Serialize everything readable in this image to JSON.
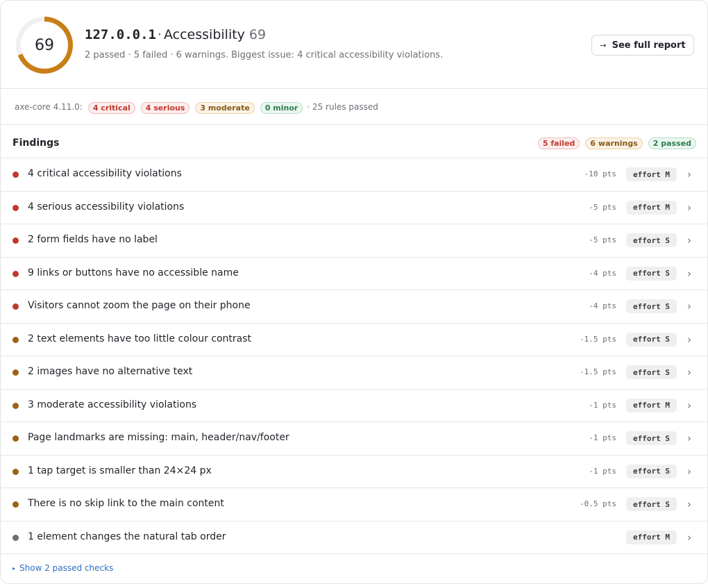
{
  "header": {
    "score": "69",
    "score_fraction": 0.69,
    "gauge_color": "#c87f17",
    "gauge_track_color": "#f0f0f0",
    "host": "127.0.0.1",
    "separator": "·",
    "category": "Accessibility",
    "category_score": "69",
    "summary": "2 passed · 5 failed · 6 warnings. Biggest issue: 4 critical accessibility violations.",
    "report_button": {
      "label": "See full report",
      "icon": "arrow-right-icon",
      "glyph": "→"
    }
  },
  "axe": {
    "label": "axe-core 4.11.0:",
    "pills": [
      {
        "label": "4 critical",
        "kind": "red"
      },
      {
        "label": "4 serious",
        "kind": "red"
      },
      {
        "label": "3 moderate",
        "kind": "orange"
      },
      {
        "label": "0 minor",
        "kind": "green"
      }
    ],
    "rules_passed": "· 25 rules passed"
  },
  "findings": {
    "title": "Findings",
    "pills": [
      {
        "label": "5 failed",
        "kind": "red"
      },
      {
        "label": "6 warnings",
        "kind": "orange"
      },
      {
        "label": "2 passed",
        "kind": "green"
      }
    ],
    "rows": [
      {
        "title": "4 critical accessibility violations",
        "pts": "-10 pts",
        "effort": "effort M",
        "severity": "red"
      },
      {
        "title": "4 serious accessibility violations",
        "pts": "-5 pts",
        "effort": "effort M",
        "severity": "red"
      },
      {
        "title": "2 form fields have no label",
        "pts": "-5 pts",
        "effort": "effort S",
        "severity": "red"
      },
      {
        "title": "9 links or buttons have no accessible name",
        "pts": "-4 pts",
        "effort": "effort S",
        "severity": "red"
      },
      {
        "title": "Visitors cannot zoom the page on their phone",
        "pts": "-4 pts",
        "effort": "effort S",
        "severity": "red"
      },
      {
        "title": "2 text elements have too little colour contrast",
        "pts": "-1.5 pts",
        "effort": "effort S",
        "severity": "orange"
      },
      {
        "title": "2 images have no alternative text",
        "pts": "-1.5 pts",
        "effort": "effort S",
        "severity": "orange"
      },
      {
        "title": "3 moderate accessibility violations",
        "pts": "-1 pts",
        "effort": "effort M",
        "severity": "orange"
      },
      {
        "title": "Page landmarks are missing: main, header/nav/footer",
        "pts": "-1 pts",
        "effort": "effort S",
        "severity": "orange"
      },
      {
        "title": "1 tap target is smaller than 24×24 px",
        "pts": "-1 pts",
        "effort": "effort S",
        "severity": "orange"
      },
      {
        "title": "There is no skip link to the main content",
        "pts": "-0.5 pts",
        "effort": "effort S",
        "severity": "orange"
      },
      {
        "title": "1 element changes the natural tab order",
        "pts": "",
        "effort": "effort M",
        "severity": "gray"
      }
    ],
    "chevron_icon": "chevron-right-icon",
    "chevron_glyph": "›"
  },
  "footer": {
    "show_passed": "Show 2 passed checks",
    "icon": "triangle-right-icon",
    "glyph": "▸"
  }
}
